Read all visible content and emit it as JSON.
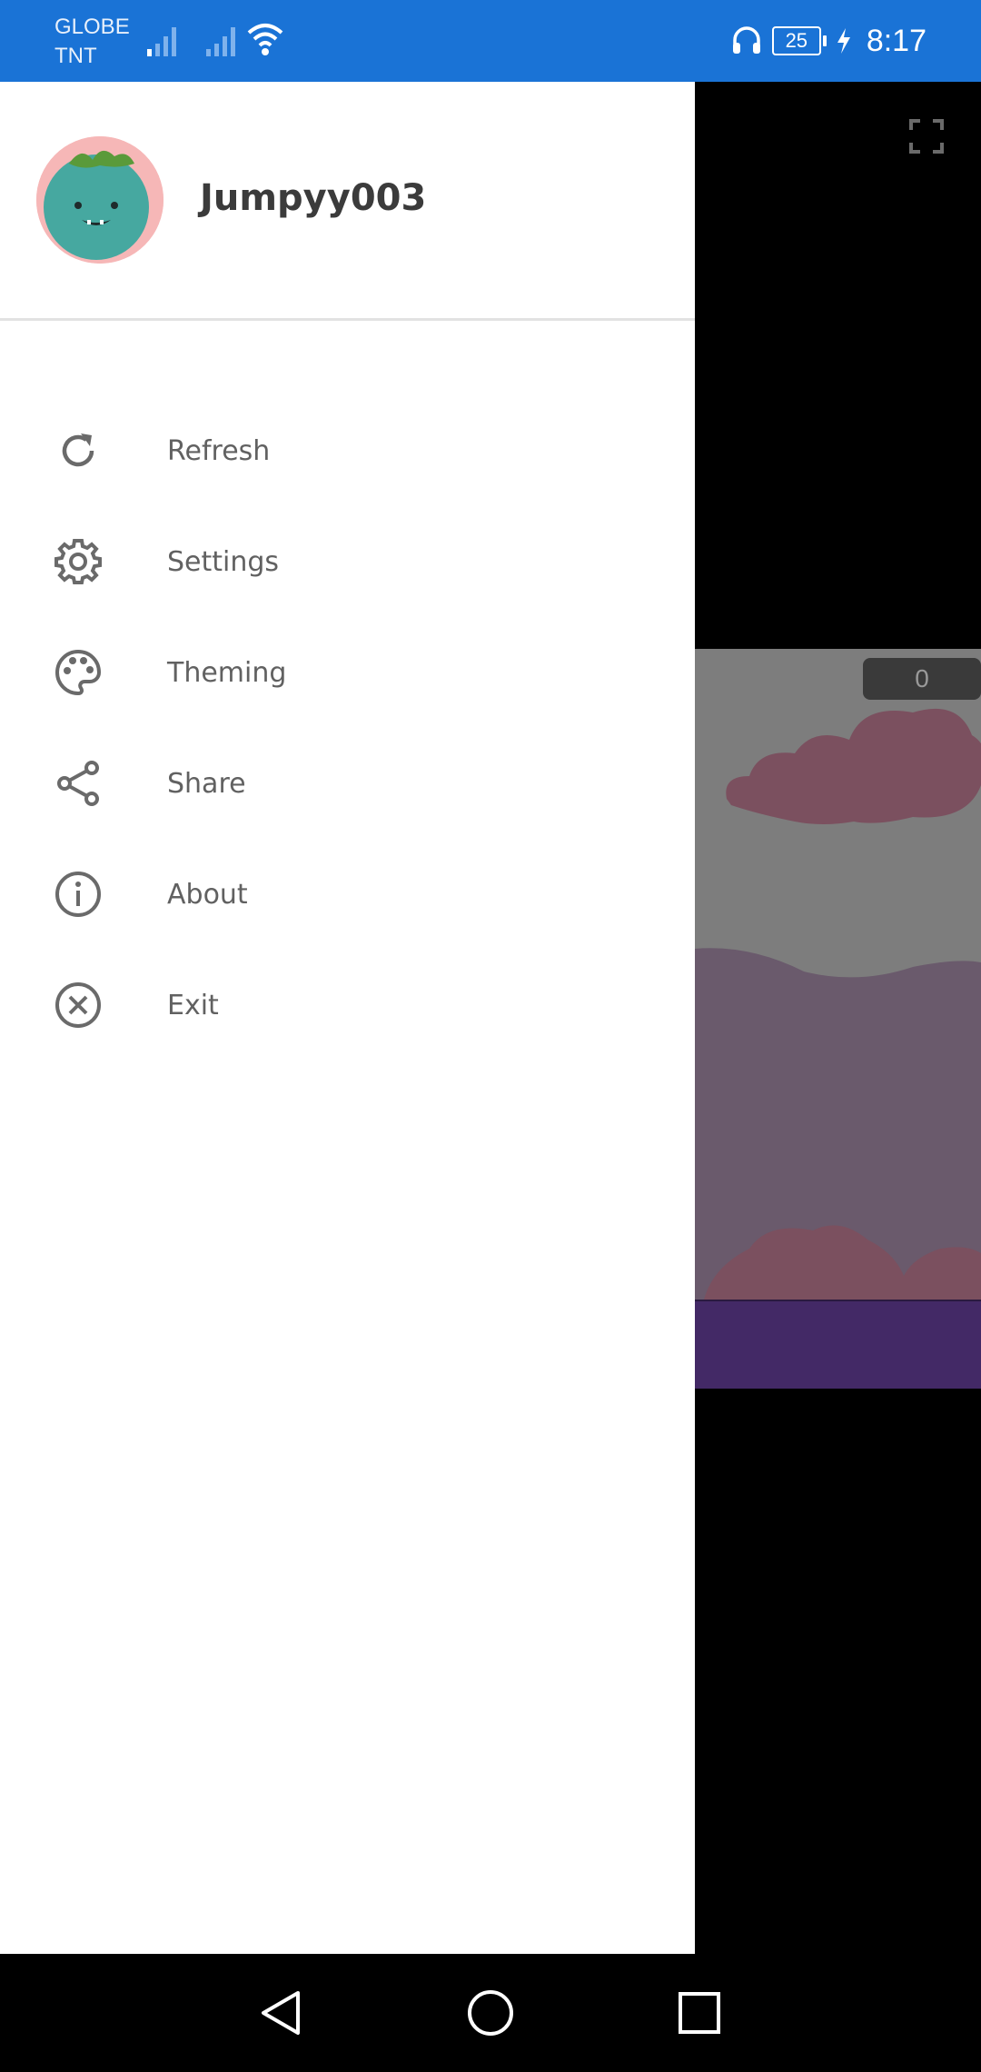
{
  "status_bar": {
    "carrier_line1": "GLOBE",
    "carrier_line2": "TNT",
    "battery": "25",
    "time": "8:17"
  },
  "drawer": {
    "username": "Jumpyy003",
    "menu": [
      {
        "label": "Refresh",
        "icon": "refresh-icon"
      },
      {
        "label": "Settings",
        "icon": "gear-icon"
      },
      {
        "label": "Theming",
        "icon": "palette-icon"
      },
      {
        "label": "Share",
        "icon": "share-icon"
      },
      {
        "label": "About",
        "icon": "info-icon"
      },
      {
        "label": "Exit",
        "icon": "close-circle-icon"
      }
    ]
  },
  "game": {
    "score": "0"
  },
  "colors": {
    "status_bar": "#1a73d6",
    "menu_text": "#616161",
    "username": "#3b3b3b",
    "ground": "#432966"
  }
}
